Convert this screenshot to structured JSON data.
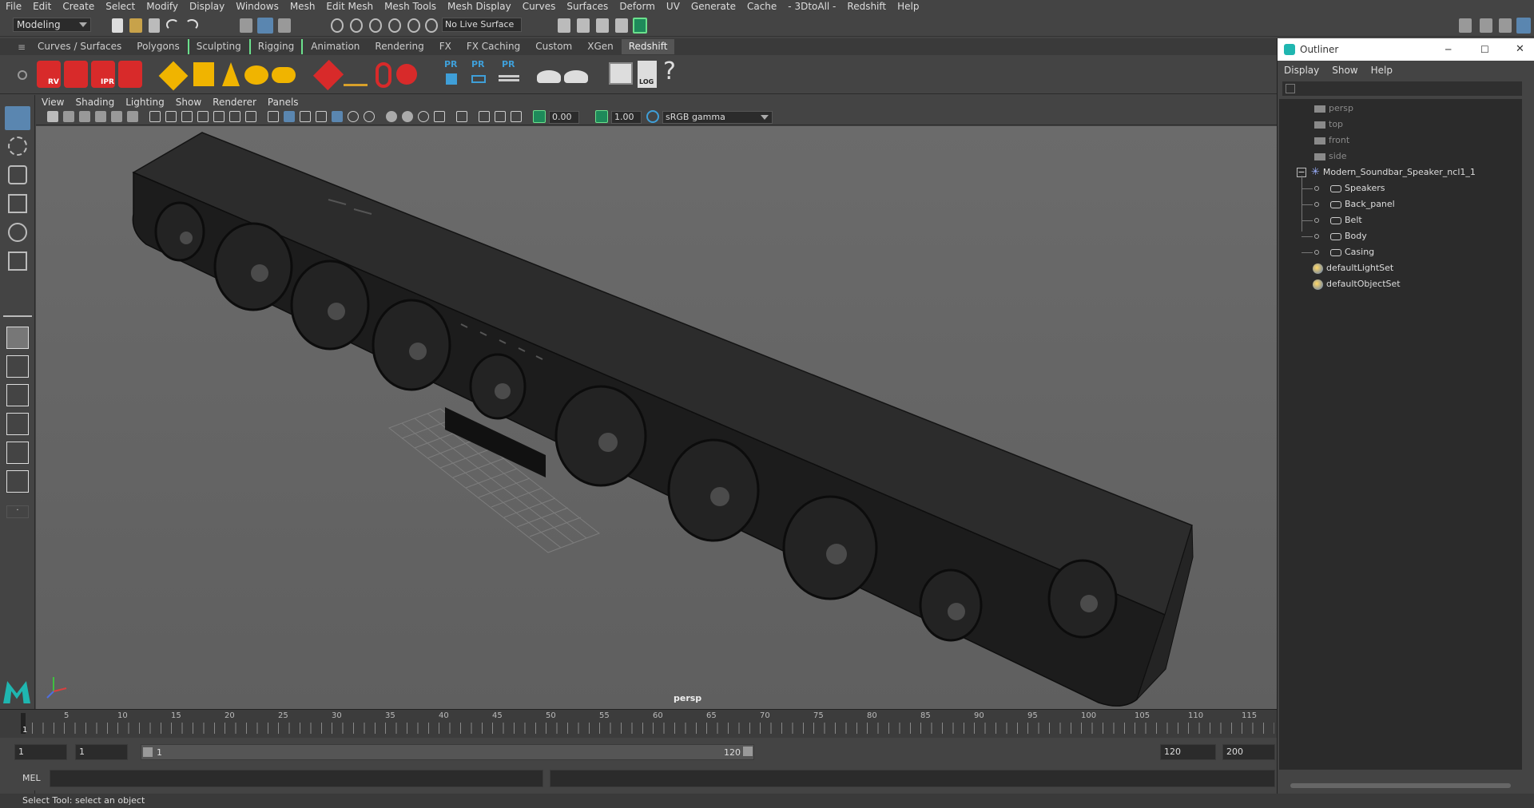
{
  "menubar": {
    "items": [
      "File",
      "Edit",
      "Create",
      "Select",
      "Modify",
      "Display",
      "Windows",
      "Mesh",
      "Edit Mesh",
      "Mesh Tools",
      "Mesh Display",
      "Curves",
      "Surfaces",
      "Deform",
      "UV",
      "Generate",
      "Cache",
      "- 3DtoAll -",
      "Redshift",
      "Help"
    ]
  },
  "status_line": {
    "mode": "Modeling",
    "live_surface": "No Live Surface"
  },
  "shelf_tabs": [
    {
      "label": "Curves / Surfaces"
    },
    {
      "label": "Polygons"
    },
    {
      "label": "Sculpting"
    },
    {
      "label": "Rigging"
    },
    {
      "label": "Animation"
    },
    {
      "label": "Rendering"
    },
    {
      "label": "FX"
    },
    {
      "label": "FX Caching"
    },
    {
      "label": "Custom"
    },
    {
      "label": "XGen"
    },
    {
      "label": "Redshift"
    }
  ],
  "shelf_icon_labels": {
    "rv": "RV",
    "ipr": "IPR",
    "pr1": "PR",
    "pr2": "PR",
    "pr3": "PR",
    "log": "LOG",
    "help": "?"
  },
  "viewport_menu": [
    "View",
    "Shading",
    "Lighting",
    "Show",
    "Renderer",
    "Panels"
  ],
  "viewport_toolbar": {
    "exposure": "0.00",
    "gamma": "1.00",
    "color_space": "sRGB gamma"
  },
  "viewport": {
    "camera_label": "persp"
  },
  "timeline": {
    "ticks": [
      "5",
      "10",
      "15",
      "20",
      "25",
      "30",
      "35",
      "40",
      "45",
      "50",
      "55",
      "60",
      "65",
      "70",
      "75",
      "80",
      "85",
      "90",
      "95",
      "100",
      "105",
      "110",
      "115"
    ],
    "current_frame": "1"
  },
  "range": {
    "start": "1",
    "current": "1",
    "slider_start": "1",
    "slider_end": "120",
    "end": "120",
    "max": "200"
  },
  "command_line": {
    "label": "MEL"
  },
  "status_text": "Select Tool: select an object",
  "outliner": {
    "title": "Outliner",
    "menu": [
      "Display",
      "Show",
      "Help"
    ],
    "items": [
      {
        "label": "persp",
        "dim": true
      },
      {
        "label": "top",
        "dim": true
      },
      {
        "label": "front",
        "dim": true
      },
      {
        "label": "side",
        "dim": true
      },
      {
        "label": "Modern_Soundbar_Speaker_ncl1_1",
        "dim": false
      },
      {
        "label": "Speakers",
        "dim": false
      },
      {
        "label": "Back_panel",
        "dim": false
      },
      {
        "label": "Belt",
        "dim": false
      },
      {
        "label": "Body",
        "dim": false
      },
      {
        "label": "Casing",
        "dim": false
      },
      {
        "label": "defaultLightSet",
        "dim": false
      },
      {
        "label": "defaultObjectSet",
        "dim": false
      }
    ]
  },
  "colors": {
    "accent": "#e8e8e8",
    "redshift_red": "#d82a2a",
    "poly_yellow": "#f0b400",
    "pr_blue": "#3f9fd8",
    "maya_teal": "#1fb6b0"
  }
}
